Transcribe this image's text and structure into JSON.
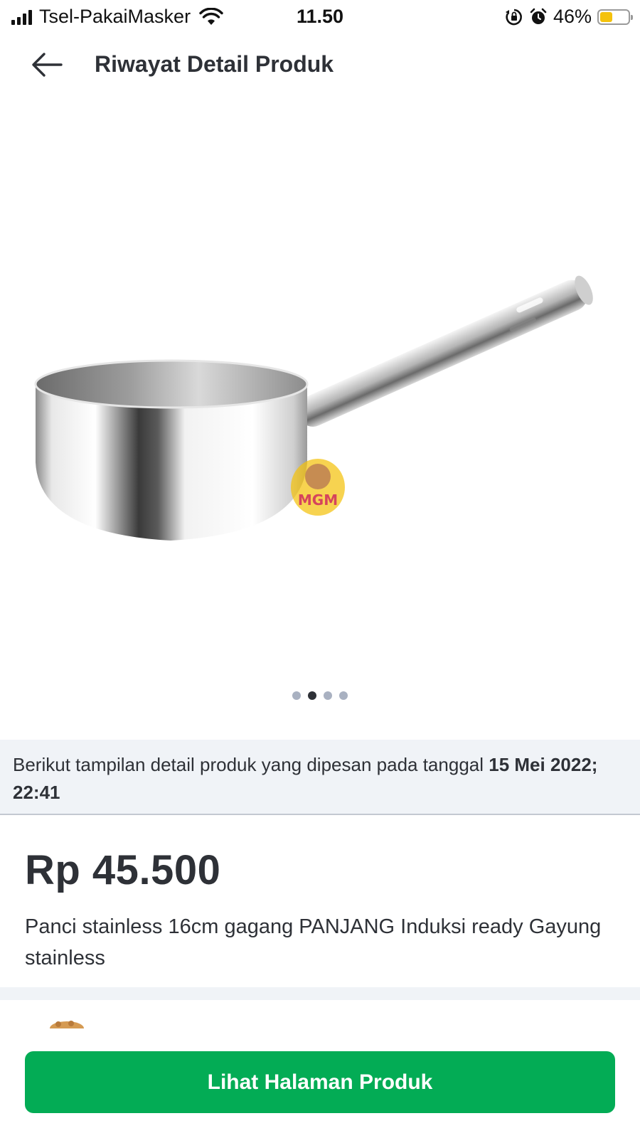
{
  "status_bar": {
    "carrier": "Tsel-PakaiMasker",
    "time": "11.50",
    "battery_percent": "46%",
    "battery_level": 0.46,
    "icons": [
      "signal-icon",
      "wifi-icon",
      "orientation-lock-icon",
      "alarm-icon",
      "battery-icon"
    ]
  },
  "header": {
    "title": "Riwayat Detail Produk",
    "back_icon": "arrow-left-icon"
  },
  "carousel": {
    "image_alt": "Panci stainless saucepan",
    "watermark": "MGM Online",
    "slide_count": 4,
    "active_index": 1
  },
  "info": {
    "text": "Berikut tampilan detail produk yang dipesan pada tanggal ",
    "date": "15 Mei 2022; 22:41"
  },
  "product": {
    "price": "Rp 45.500",
    "name": "Panci stainless 16cm gagang PANJANG Induksi ready Gayung stainless"
  },
  "cta": {
    "label": "Lihat Halaman Produk"
  },
  "colors": {
    "primary_green": "#03ac55",
    "text_dark": "#2e3137",
    "banner_bg": "#f0f3f7"
  }
}
